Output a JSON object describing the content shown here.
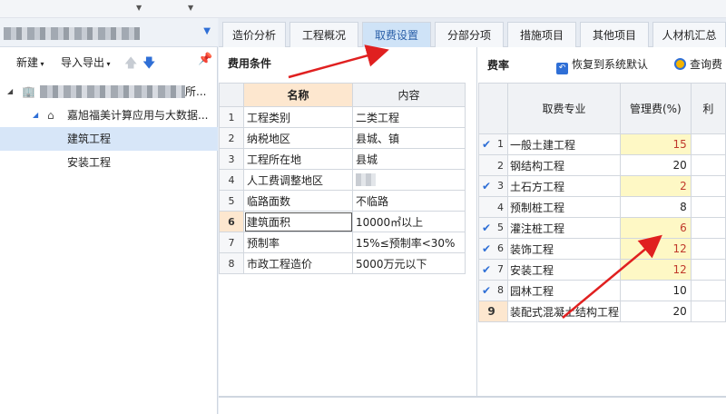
{
  "project_panel": {
    "new_label": "新建",
    "import_export_label": "导入导出",
    "tree": [
      {
        "label": "",
        "level": 0
      },
      {
        "label": "嘉旭福美计算应用与大数据...",
        "level": 1
      },
      {
        "label": "建筑工程",
        "level": 2,
        "selected": true
      },
      {
        "label": "安装工程",
        "level": 2
      }
    ]
  },
  "tabs": [
    {
      "label": "造价分析"
    },
    {
      "label": "工程概况"
    },
    {
      "label": "取费设置",
      "active": true
    },
    {
      "label": "分部分项"
    },
    {
      "label": "措施项目"
    },
    {
      "label": "其他项目"
    },
    {
      "label": "人材机汇总"
    }
  ],
  "fee_conditions": {
    "title": "费用条件",
    "col_name": "名称",
    "col_content": "内容",
    "rows": [
      {
        "no": "1",
        "name": "工程类别",
        "value": "二类工程"
      },
      {
        "no": "2",
        "name": "纳税地区",
        "value": "县城、镇"
      },
      {
        "no": "3",
        "name": "工程所在地",
        "value": "县城"
      },
      {
        "no": "4",
        "name": "人工费调整地区",
        "value": ""
      },
      {
        "no": "5",
        "name": "临路面数",
        "value": "不临路"
      },
      {
        "no": "6",
        "name": "建筑面积",
        "value": "10000㎡以上",
        "current": true
      },
      {
        "no": "7",
        "name": "预制率",
        "value": "15%≤预制率<30%"
      },
      {
        "no": "8",
        "name": "市政工程造价",
        "value": "5000万元以下"
      }
    ]
  },
  "fee_rate": {
    "title": "费率",
    "restore_label": "恢复到系统默认",
    "query_label": "查询费",
    "col_spec": "取费专业",
    "col_mgmt": "管理费(%)",
    "col_profit": "利",
    "rows": [
      {
        "no": "1",
        "spec": "一般土建工程",
        "mgmt": "15",
        "checked": true,
        "highlight": true
      },
      {
        "no": "2",
        "spec": "钢结构工程",
        "mgmt": "20",
        "checked": false,
        "highlight": false
      },
      {
        "no": "3",
        "spec": "土石方工程",
        "mgmt": "2",
        "checked": true,
        "highlight": true
      },
      {
        "no": "4",
        "spec": "预制桩工程",
        "mgmt": "8",
        "checked": false,
        "highlight": false
      },
      {
        "no": "5",
        "spec": "灌注桩工程",
        "mgmt": "6",
        "checked": true,
        "highlight": true
      },
      {
        "no": "6",
        "spec": "装饰工程",
        "mgmt": "12",
        "checked": true,
        "highlight": true
      },
      {
        "no": "7",
        "spec": "安装工程",
        "mgmt": "12",
        "checked": true,
        "highlight": true
      },
      {
        "no": "8",
        "spec": "园林工程",
        "mgmt": "10",
        "checked": true,
        "highlight": false
      },
      {
        "no": "9",
        "spec": "装配式混凝土结构工程",
        "mgmt": "20",
        "checked": false,
        "highlight": false,
        "current": true
      }
    ]
  },
  "colors": {
    "accent": "#2f6fd6",
    "active_tab": "#cfe3f7",
    "header_highlight": "#fde7cf",
    "cell_highlight": "#fef8c5",
    "annotation_arrow": "#e02020"
  }
}
